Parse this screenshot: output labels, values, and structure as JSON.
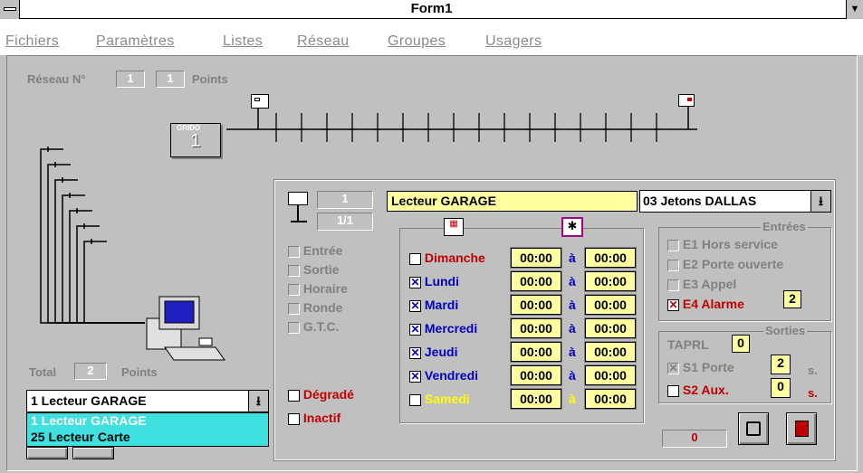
{
  "window": {
    "title": "Form1"
  },
  "menu": [
    "Fichiers",
    "Paramètres",
    "Listes",
    "Réseau",
    "Groupes",
    "Usagers"
  ],
  "network": {
    "label": "Réseau N°",
    "num1": "1",
    "num2": "1",
    "points_label": "Points",
    "device": "GRIDO",
    "device_num": "1"
  },
  "total": {
    "label": "Total",
    "value": "2",
    "points": "Points"
  },
  "reader_select": {
    "value": "1  Lecteur GARAGE",
    "options": [
      "1  Lecteur GARAGE",
      "25  Lecteur Carte"
    ]
  },
  "panel": {
    "reader_num": "1",
    "reader_page": "1/1",
    "reader_name": "Lecteur GARAGE",
    "token_type": "03 Jetons DALLAS",
    "modes": [
      "Entrée",
      "Sortie",
      "Horaire",
      "Ronde",
      "G.T.C."
    ],
    "degrade": "Dégradé",
    "inactif": "Inactif",
    "days": [
      {
        "name": "Dimanche",
        "checked": false,
        "from": "00:00",
        "to": "00:00",
        "color": "#c00000"
      },
      {
        "name": "Lundi",
        "checked": true,
        "from": "00:00",
        "to": "00:00",
        "color": "#0000c0"
      },
      {
        "name": "Mardi",
        "checked": true,
        "from": "00:00",
        "to": "00:00",
        "color": "#0000c0"
      },
      {
        "name": "Mercredi",
        "checked": true,
        "from": "00:00",
        "to": "00:00",
        "color": "#0000c0"
      },
      {
        "name": "Jeudi",
        "checked": true,
        "from": "00:00",
        "to": "00:00",
        "color": "#0000c0"
      },
      {
        "name": "Vendredi",
        "checked": true,
        "from": "00:00",
        "to": "00:00",
        "color": "#0000c0"
      },
      {
        "name": "Samedi",
        "checked": false,
        "from": "00:00",
        "to": "00:00",
        "color": "#ffff00"
      }
    ],
    "a_label": "à",
    "entrees": {
      "title": "Entrées",
      "items": [
        "E1 Hors service",
        "E2 Porte ouverte",
        "E3 Appel",
        "E4  Alarme"
      ],
      "alarm_value": "2"
    },
    "sorties": {
      "title": "Sorties",
      "taprl": "TAPRL",
      "taprl_value": "0",
      "s1": "S1 Porte",
      "s1_value": "2",
      "s1_unit": "s.",
      "s2": "S2 Aux.",
      "s2_value": "0",
      "s2_unit": "s."
    },
    "counter": "0"
  }
}
